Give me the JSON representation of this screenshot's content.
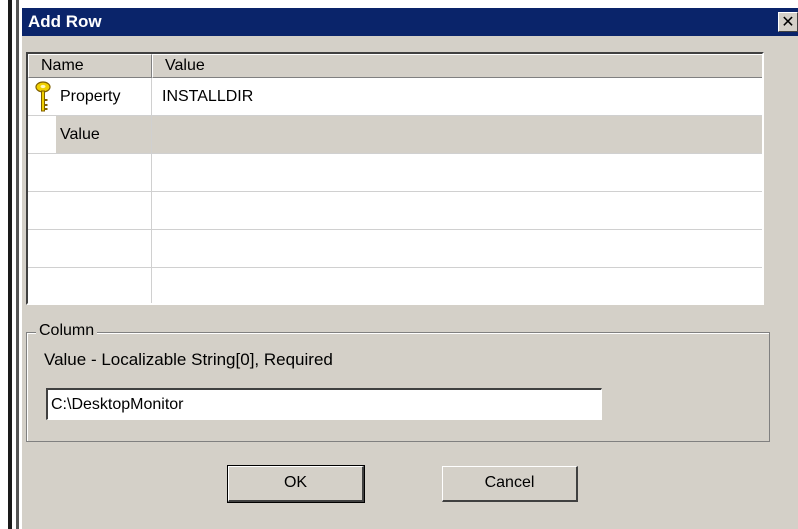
{
  "window": {
    "title": "Add Row",
    "close_glyph": "✕"
  },
  "grid": {
    "headers": [
      "Name",
      "Value"
    ],
    "rows": [
      {
        "name": "Property",
        "value": "INSTALLDIR",
        "icon": "key-icon"
      },
      {
        "name": "Value",
        "value": ""
      },
      {
        "name": "",
        "value": ""
      },
      {
        "name": "",
        "value": ""
      },
      {
        "name": "",
        "value": ""
      },
      {
        "name": "",
        "value": ""
      }
    ]
  },
  "column": {
    "legend": "Column",
    "description": "Value - Localizable String[0], Required",
    "input_value": "C:\\DesktopMonitor"
  },
  "buttons": {
    "ok": "OK",
    "cancel": "Cancel"
  },
  "colors": {
    "titlebar": "#0a246a",
    "face": "#d4d0c8"
  }
}
